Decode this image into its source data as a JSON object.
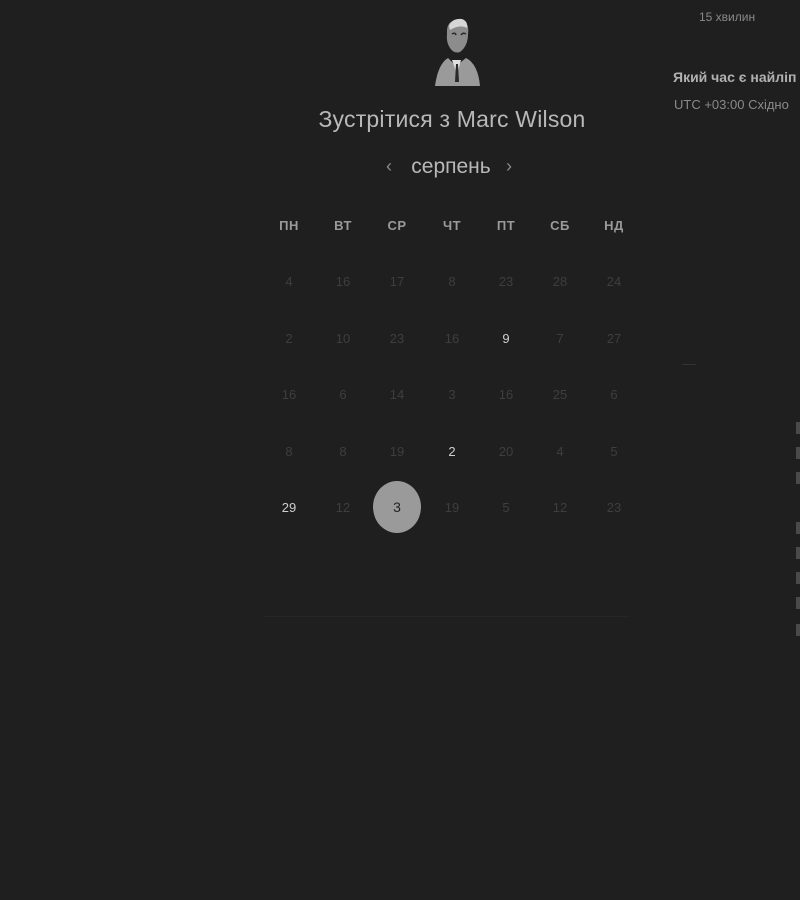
{
  "header": {
    "title": "Зустрітися з Marc Wilson",
    "avatar_icon": "person-portrait-icon"
  },
  "calendar": {
    "month": "серпень",
    "prev_icon": "chevron-left-icon",
    "next_icon": "chevron-right-icon",
    "weekdays": [
      "ПН",
      "ВТ",
      "СР",
      "ЧТ",
      "ПТ",
      "СБ",
      "НД"
    ],
    "weeks": [
      [
        {
          "d": "4",
          "a": false
        },
        {
          "d": "16",
          "a": false
        },
        {
          "d": "17",
          "a": false
        },
        {
          "d": "8",
          "a": false
        },
        {
          "d": "23",
          "a": false
        },
        {
          "d": "28",
          "a": false
        },
        {
          "d": "24",
          "a": false
        }
      ],
      [
        {
          "d": "2",
          "a": false
        },
        {
          "d": "10",
          "a": false
        },
        {
          "d": "23",
          "a": false
        },
        {
          "d": "16",
          "a": false
        },
        {
          "d": "9",
          "a": true
        },
        {
          "d": "7",
          "a": false
        },
        {
          "d": "27",
          "a": false
        }
      ],
      [
        {
          "d": "16",
          "a": false
        },
        {
          "d": "6",
          "a": false
        },
        {
          "d": "14",
          "a": false
        },
        {
          "d": "3",
          "a": false
        },
        {
          "d": "16",
          "a": false
        },
        {
          "d": "25",
          "a": false
        },
        {
          "d": "6",
          "a": false
        }
      ],
      [
        {
          "d": "8",
          "a": false
        },
        {
          "d": "8",
          "a": false
        },
        {
          "d": "19",
          "a": false
        },
        {
          "d": "2",
          "a": true
        },
        {
          "d": "20",
          "a": false
        },
        {
          "d": "4",
          "a": false
        },
        {
          "d": "5",
          "a": false
        }
      ],
      [
        {
          "d": "29",
          "a": true
        },
        {
          "d": "12",
          "a": false
        },
        {
          "d": "3",
          "a": true,
          "selected": true
        },
        {
          "d": "19",
          "a": false
        },
        {
          "d": "5",
          "a": false
        },
        {
          "d": "12",
          "a": false
        },
        {
          "d": "23",
          "a": false
        }
      ]
    ],
    "selected_color": "#9a9a9a"
  },
  "side_panel": {
    "duration": "15 хвилин",
    "question": "Який час є найліп",
    "timezone": "UTC +03:00 Східно"
  }
}
